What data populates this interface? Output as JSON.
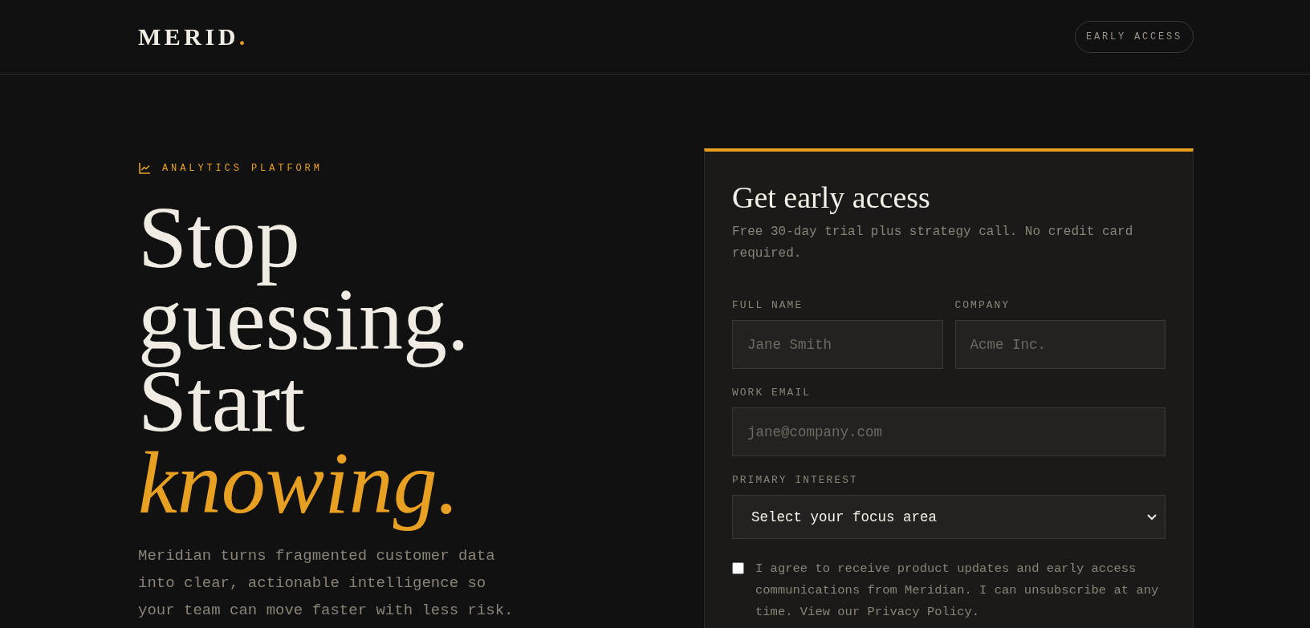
{
  "header": {
    "logo": "MERID",
    "logo_dot": ".",
    "button": "EARLY ACCESS"
  },
  "hero": {
    "eyebrow": "ANALYTICS PLATFORM",
    "headline_lines": [
      "Stop",
      "guessing.",
      "Start"
    ],
    "headline_accent": "knowing.",
    "paragraph": "Meridian turns fragmented customer data into clear, actionable intelligence so your team can move faster with less risk."
  },
  "form": {
    "title": "Get early access",
    "subtitle": "Free 30-day trial plus strategy call. No credit card required.",
    "fields": [
      {
        "kind": "input",
        "label": "FULL NAME",
        "placeholder": "Jane Smith",
        "half": true
      },
      {
        "kind": "input",
        "label": "COMPANY",
        "placeholder": "Acme Inc.",
        "half": true
      },
      {
        "kind": "input",
        "label": "WORK EMAIL",
        "placeholder": "jane@company.com",
        "half": false
      },
      {
        "kind": "select",
        "label": "PRIMARY INTEREST",
        "value": "Select your focus area",
        "half": false
      }
    ],
    "consent": {
      "checked": false,
      "text": "I agree to receive product updates and early access communications from Meridian. I can unsubscribe at any time. View our Privacy Policy."
    }
  }
}
